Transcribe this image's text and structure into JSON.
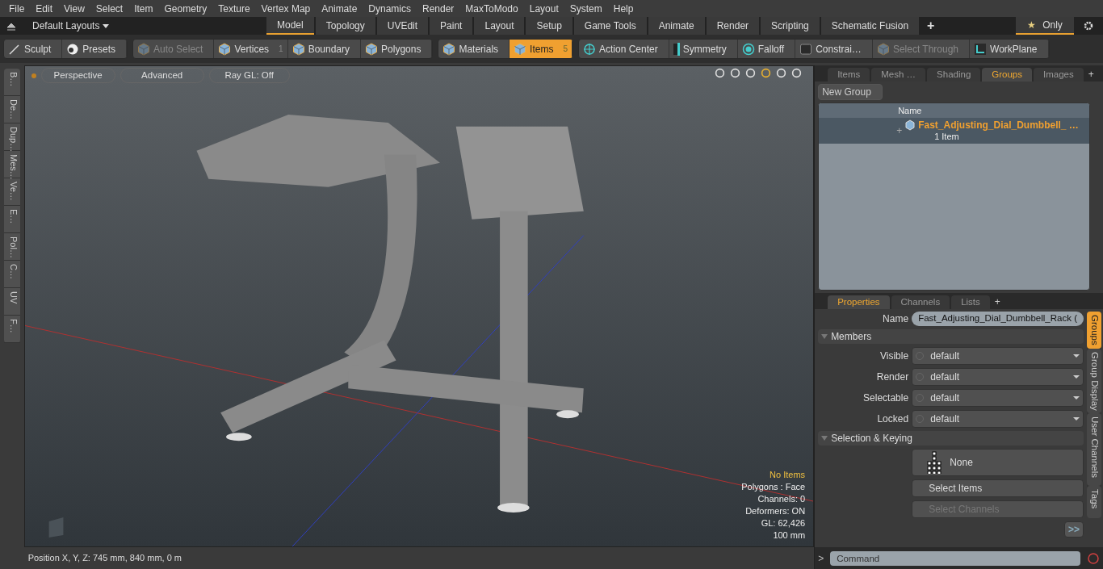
{
  "menu": [
    "File",
    "Edit",
    "View",
    "Select",
    "Item",
    "Geometry",
    "Texture",
    "Vertex Map",
    "Animate",
    "Dynamics",
    "Render",
    "MaxToModo",
    "Layout",
    "System",
    "Help"
  ],
  "layout_bar": {
    "title": "Default Layouts",
    "tabs": [
      {
        "label": "Model",
        "selected": true
      },
      {
        "label": "Topology",
        "selected": false
      },
      {
        "label": "UVEdit",
        "selected": false
      },
      {
        "label": "Paint",
        "selected": false
      },
      {
        "label": "Layout",
        "selected": false
      },
      {
        "label": "Setup",
        "selected": false
      },
      {
        "label": "Game Tools",
        "selected": false
      },
      {
        "label": "Animate",
        "selected": false
      },
      {
        "label": "Render",
        "selected": false
      },
      {
        "label": "Scripting",
        "selected": false
      },
      {
        "label": "Schematic Fusion",
        "selected": false
      }
    ],
    "add": "+",
    "only": "Only",
    "star": "★"
  },
  "toolbar": [
    [
      {
        "label": "Sculpt",
        "kind": "brush",
        "selected": false,
        "disabled": false
      },
      {
        "label": "Presets",
        "kind": "sphere",
        "selected": false,
        "disabled": false
      }
    ],
    [
      {
        "label": "Auto Select",
        "kind": "cube",
        "selected": false,
        "disabled": true
      },
      {
        "label": "Vertices",
        "kind": "cube",
        "selected": false,
        "disabled": false,
        "count": "1"
      },
      {
        "label": "Boundary",
        "kind": "cube",
        "selected": false,
        "disabled": false
      },
      {
        "label": "Polygons",
        "kind": "cube",
        "selected": false,
        "disabled": false
      }
    ],
    [
      {
        "label": "Materials",
        "kind": "cube",
        "selected": false,
        "disabled": false
      },
      {
        "label": "Items",
        "kind": "cube",
        "selected": true,
        "disabled": false,
        "count": "5"
      }
    ],
    [
      {
        "label": "Action Center",
        "kind": "target",
        "selected": false,
        "disabled": false
      },
      {
        "label": "Symmetry",
        "kind": "bar",
        "selected": false,
        "disabled": false
      },
      {
        "label": "Falloff",
        "kind": "ring",
        "selected": false,
        "disabled": false
      },
      {
        "label": "Constrai…",
        "kind": "square",
        "selected": false,
        "disabled": false
      },
      {
        "label": "Select Through",
        "kind": "cube",
        "selected": false,
        "disabled": true
      },
      {
        "label": "WorkPlane",
        "kind": "corner",
        "selected": false,
        "disabled": false
      }
    ]
  ],
  "left_tabs": [
    "B…",
    "De…",
    "Dup…",
    "Mes…",
    "Ve…",
    "E…",
    "Pol…",
    "C…",
    "UV",
    "F…"
  ],
  "viewport": {
    "buttons": [
      "Perspective",
      "Advanced",
      "Ray GL: Off"
    ],
    "info": [
      {
        "text": "No Items",
        "kind": "highlight"
      },
      {
        "text": "Polygons : Face",
        "kind": "plain"
      },
      {
        "text": "Channels: 0",
        "kind": "plain"
      },
      {
        "text": "Deformers: ON",
        "kind": "plain"
      },
      {
        "text": "GL: 62,426",
        "kind": "plain"
      },
      {
        "text": "100 mm",
        "kind": "plain"
      }
    ]
  },
  "groups_panel": {
    "tabs": [
      {
        "label": "Items",
        "selected": false
      },
      {
        "label": "Mesh …",
        "selected": false
      },
      {
        "label": "Shading",
        "selected": false
      },
      {
        "label": "Groups",
        "selected": true
      },
      {
        "label": "Images",
        "selected": false
      }
    ],
    "add": "+",
    "new_group": "New Group",
    "name_column": "Name",
    "rows": [
      {
        "name": "Fast_Adjusting_Dial_Dumbbell_ …",
        "count": "1 Item",
        "expander": "+"
      }
    ]
  },
  "properties": {
    "tabs": [
      {
        "label": "Properties",
        "selected": true
      },
      {
        "label": "Channels",
        "selected": false
      },
      {
        "label": "Lists",
        "selected": false
      }
    ],
    "add": "+",
    "name_label": "Name",
    "name_value": "Fast_Adjusting_Dial_Dumbbell_Rack (",
    "sections": [
      {
        "title": "Members",
        "rows": [
          {
            "label": "Visible",
            "value": "default"
          },
          {
            "label": "Render",
            "value": "default"
          },
          {
            "label": "Selectable",
            "value": "default"
          },
          {
            "label": "Locked",
            "value": "default"
          }
        ]
      },
      {
        "title": "Selection & Keying",
        "buttons": [
          {
            "label": "None",
            "kind": "tree",
            "disabled": false
          },
          {
            "label": "Select Items",
            "kind": "plain",
            "disabled": false
          },
          {
            "label": "Select Channels",
            "kind": "plain",
            "disabled": true
          }
        ]
      }
    ],
    "more": ">>",
    "side_tabs": [
      {
        "label": "Groups",
        "selected": true
      },
      {
        "label": "Group Display",
        "selected": false
      },
      {
        "label": "User Channels",
        "selected": false
      },
      {
        "label": "Tags",
        "selected": false
      }
    ]
  },
  "command": {
    "prompt": ">",
    "placeholder": "Command"
  },
  "status_bar": "Position X, Y, Z:   745 mm, 840 mm, 0 m"
}
